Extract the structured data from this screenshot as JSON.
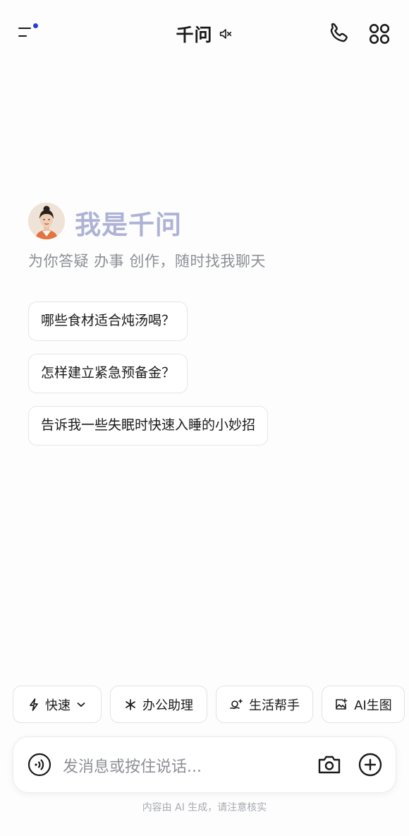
{
  "header": {
    "title": "千问",
    "menu_icon": "menu-icon",
    "mute_icon": "speaker-muted-icon",
    "phone_icon": "phone-icon",
    "apps_icon": "apps-grid-icon",
    "notification_dot_color": "#2d3bd6"
  },
  "greeting": {
    "title": "我是千问",
    "subtitle": "为你答疑 办事 创作，随时找我聊天",
    "title_color": "#aeb3d6"
  },
  "suggestions": [
    "哪些食材适合炖汤喝？",
    "怎样建立紧急预备金？",
    "告诉我一些失眠时快速入睡的小妙招"
  ],
  "chips": [
    {
      "label": "快速",
      "icon": "lightning-icon",
      "has_dropdown": true
    },
    {
      "label": "办公助理",
      "icon": "asterisk-icon"
    },
    {
      "label": "生活帮手",
      "icon": "life-helper-icon"
    },
    {
      "label": "AI生图",
      "icon": "image-sparkle-icon"
    }
  ],
  "input": {
    "placeholder": "发消息或按住说话...",
    "voice_icon": "voice-icon",
    "camera_icon": "camera-icon",
    "plus_icon": "plus-icon"
  },
  "disclaimer": "内容由 AI 生成，请注意核实"
}
